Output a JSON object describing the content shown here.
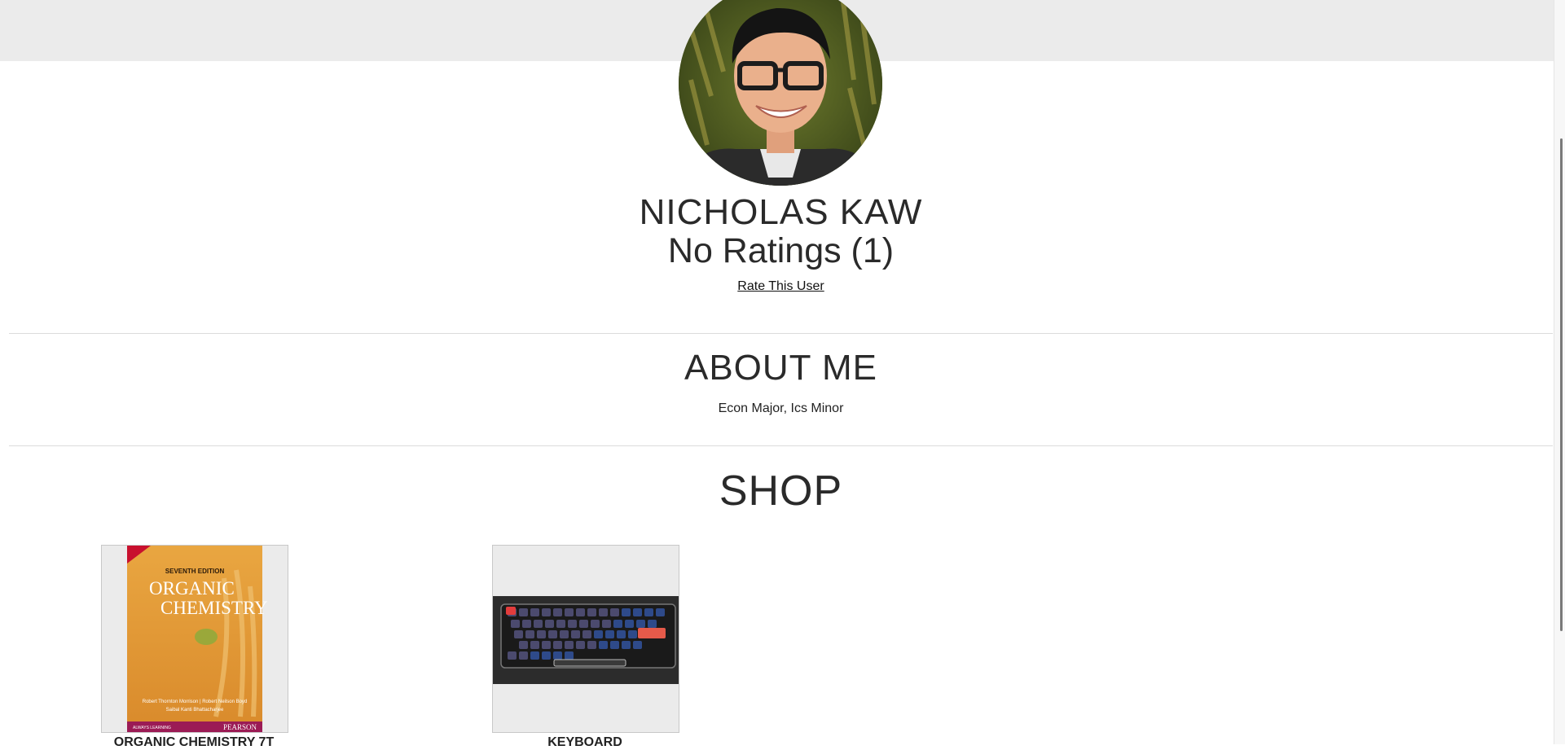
{
  "profile": {
    "name": "NICHOLAS KAW",
    "rating": "No Ratings (1)",
    "rate_link": "Rate This User"
  },
  "about": {
    "heading": "ABOUT ME",
    "text": "Econ Major, Ics Minor"
  },
  "shop": {
    "heading": "SHOP",
    "items": [
      {
        "title": "ORGANIC CHEMISTRY 7T",
        "cover": {
          "edition": "SEVENTH EDITION",
          "title_line1": "ORGANIC",
          "title_line2": "CHEMISTRY",
          "authors_line1": "Robert Thornton Morrison  |  Robert Neilson Boyd",
          "authors_line2": "Saibal Kanti Bhattacharjee",
          "series": "ALWAYS LEARNING",
          "publisher": "PEARSON"
        }
      },
      {
        "title": "KEYBOARD"
      }
    ]
  },
  "colors": {
    "header_band": "#ebebeb",
    "divider": "#dcdcdc",
    "book_cover": "#e8a33c",
    "book_footer": "#9b1b55"
  }
}
